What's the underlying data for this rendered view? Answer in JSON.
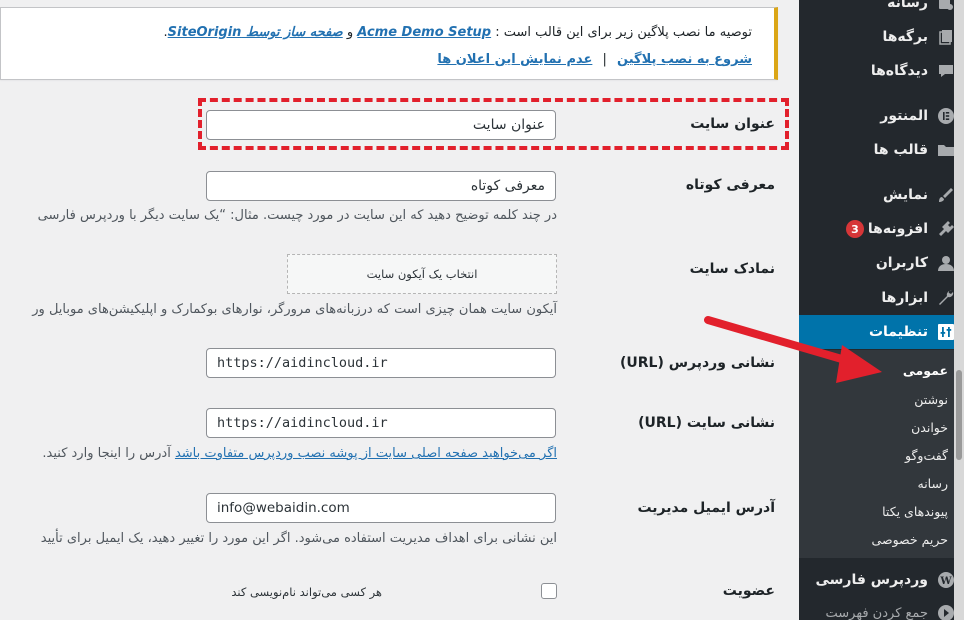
{
  "notice": {
    "line1_prefix": "توصیه ما نصب پلاگین زیر برای این قالب است :",
    "plugin1": "Acme Demo Setup",
    "conj": "و",
    "plugin2_prefix": "صفحه ساز توسط",
    "plugin2_brand": "SiteOrigin",
    "plugin2_dot": ".",
    "begin_install": "شروع به نصب پلاگین",
    "separator": "|",
    "dismiss": "عدم نمایش این اعلان ها"
  },
  "form": {
    "site_title": {
      "label": "عنوان سایت",
      "value": "عنوان سایت"
    },
    "tagline": {
      "label": "معرفی کوتاه",
      "value": "معرفی کوتاه",
      "description": "در چند کلمه توضیح دهید که این سایت در مورد چیست. مثال: “یک سایت دیگر با وردپرس فارسی"
    },
    "site_icon": {
      "label": "نمادک سایت",
      "button": "انتخاب یک آیکون سایت",
      "description": "آیکون سایت همان چیزی است که درزبانه‌های مرورگر، نوارهای بوکمارک و اپلیکیشن‌های موبایل ور"
    },
    "wp_url": {
      "label": "نشانی وردپرس (URL)",
      "value": "https://aidincloud.ir"
    },
    "site_url": {
      "label": "نشانی سایت (URL)",
      "value": "https://aidincloud.ir",
      "description_link": "اگر می‌خواهید صفحه اصلی سایت از پوشه نصب وردپرس متفاوت باشد",
      "description_suffix": "آدرس را اینجا وارد کنید."
    },
    "admin_email": {
      "label": "آدرس ایمیل مدیریت",
      "value": "info@webaidin.com",
      "description": "این نشانی برای اهداف مدیریت استفاده می‌شود. اگر این مورد را تغییر دهید، یک ایمیل برای تأیید"
    },
    "membership": {
      "label": "عضویت",
      "checkbox_label": "هر کسی می‌تواند نام‌نویسی کند"
    }
  },
  "sidebar": {
    "items": [
      {
        "label": "رسانه",
        "icon": "media-icon"
      },
      {
        "label": "برگه‌ها",
        "icon": "pages-icon"
      },
      {
        "label": "دیدگاه‌ها",
        "icon": "comments-icon"
      },
      {
        "label": "المنتور",
        "icon": "elementor-icon"
      },
      {
        "label": "قالب ها",
        "icon": "folder-icon"
      },
      {
        "label": "نمایش",
        "icon": "appearance-icon"
      },
      {
        "label": "افزونه‌ها",
        "icon": "plugins-icon",
        "badge": "3"
      },
      {
        "label": "کاربران",
        "icon": "users-icon"
      },
      {
        "label": "ابزارها",
        "icon": "tools-icon"
      },
      {
        "label": "تنظیمات",
        "icon": "settings-icon",
        "active": true
      },
      {
        "label": "وردپرس فارسی",
        "icon": "wp-persian-icon"
      },
      {
        "label": "جمع کردن فهرست",
        "icon": "collapse-icon"
      }
    ],
    "submenu": [
      "عمومی",
      "نوشتن",
      "خواندن",
      "گفت‌وگو",
      "رسانه",
      "پیوندهای یکتا",
      "حریم خصوصی"
    ]
  },
  "colors": {
    "sidebar_bg": "#23282d",
    "submenu_bg": "#32373c",
    "active_bg": "#0073aa",
    "link": "#2271b1",
    "notice_border": "#dba617",
    "annotation_red": "#e2202c",
    "badge": "#d63638"
  }
}
